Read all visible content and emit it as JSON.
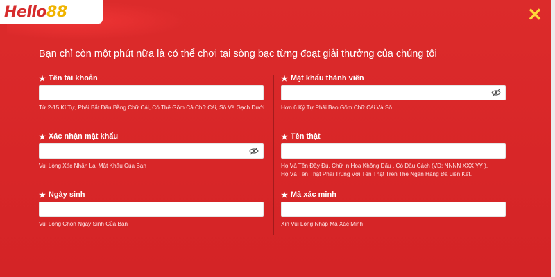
{
  "brand": {
    "logo_text": "Hello",
    "logo_number": "88"
  },
  "headline": "Bạn chỉ còn một phút nữa là có thể chơi tại sòng bạc từng đoạt giải thưởng của chúng tôi",
  "fields": {
    "username": {
      "label": "Tên tài khoản",
      "hint": "Từ 2-15 Kí Tự, Phải Bắt Đầu Bằng Chữ Cái, Có Thể Gồm Cả Chữ Cái, Số Và Gạch Dưới."
    },
    "member_password": {
      "label": "Mật khẩu thành viên",
      "hint": "Hơn 6 Ký Tự Phải Bao Gồm Chữ Cái Và Số"
    },
    "confirm_password": {
      "label": "Xác nhận mật khẩu",
      "hint": "Vui Lòng Xác Nhận Lại Mật Khẩu Của Bạn"
    },
    "real_name": {
      "label": "Tên thật",
      "hint_line1": "Họ Và Tên Đầy Đủ, Chữ In Hoa Không Dấu , Có Dấu Cách (VD: NNNN XXX YY ).",
      "hint_line2": "Họ Và Tên Thật Phải Trùng Với Tên Thật Trên Thẻ Ngân Hàng Đã Liên Kết."
    },
    "birthday": {
      "label": "Ngày sinh",
      "hint": "Vui Lòng Chọn Ngày Sinh Của Bạn"
    },
    "verification_code": {
      "label": "Mã xác minh",
      "hint": "Xin Vui Lòng Nhập Mã Xác Minh"
    }
  },
  "icons": {
    "close": "close-icon",
    "eye_hidden": "eye-slash-icon",
    "required": "star-icon"
  },
  "colors": {
    "background": "#d9262a",
    "close": "#ffd83a",
    "logo_red": "#d62d2d",
    "logo_gold": "#f0b400"
  }
}
